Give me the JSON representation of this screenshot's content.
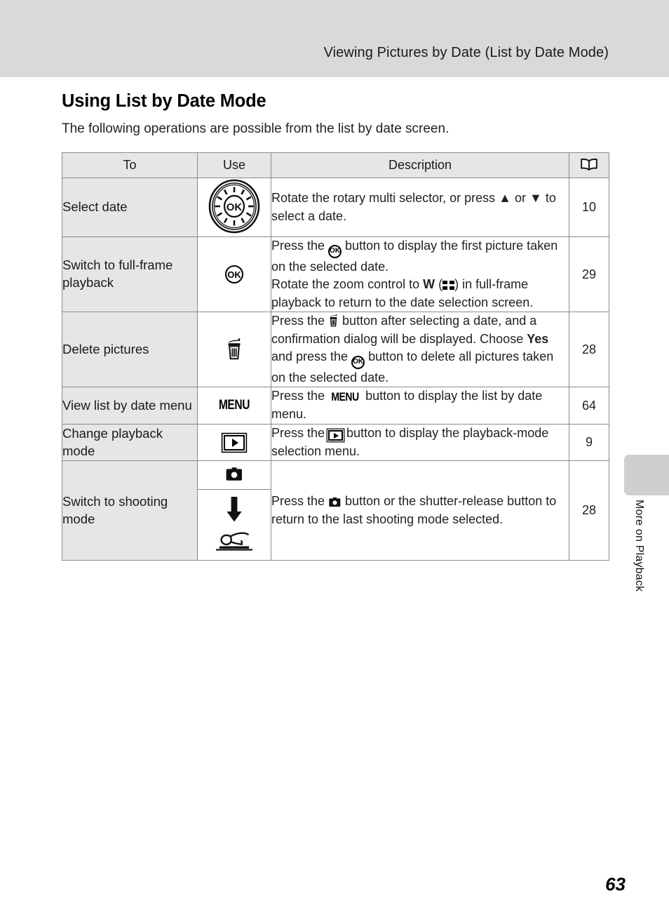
{
  "header": {
    "running_title": "Viewing Pictures by Date (List by Date Mode)"
  },
  "section": {
    "title": "Using List by Date Mode",
    "intro": "The following operations are possible from the list by date screen."
  },
  "table": {
    "columns": {
      "to": "To",
      "use": "Use",
      "description": "Description",
      "reference_icon": "open-book-icon"
    },
    "rows": [
      {
        "to": "Select date",
        "use_icon": "rotary-multi-selector-dial-icon",
        "description_parts": [
          {
            "text": "Rotate the rotary multi selector, or press "
          },
          {
            "icon": "up-triangle-icon",
            "glyph": "▲"
          },
          {
            "text": " or "
          },
          {
            "icon": "down-triangle-icon",
            "glyph": "▼"
          },
          {
            "text": " to select a date."
          }
        ],
        "reference": "10"
      },
      {
        "to": "Switch to full-frame playback",
        "use_icon": "ok-button-icon",
        "use_label": "OK",
        "description_parts": [
          {
            "text": "Press the "
          },
          {
            "icon": "ok-button-icon",
            "glyph": "OK"
          },
          {
            "text": " button to display the first picture taken on the selected date."
          },
          {
            "break": true
          },
          {
            "text": "Rotate the zoom control to "
          },
          {
            "bold": "W"
          },
          {
            "text": " ("
          },
          {
            "icon": "thumbnail-view-icon"
          },
          {
            "text": ") in full-frame playback to return to the date selection screen."
          }
        ],
        "reference": "29"
      },
      {
        "to": "Delete pictures",
        "use_icon": "trash-can-icon",
        "description_parts": [
          {
            "text": "Press the "
          },
          {
            "icon": "trash-can-icon"
          },
          {
            "text": " button after selecting a date, and a confirmation dialog will be displayed. Choose "
          },
          {
            "bold": "Yes"
          },
          {
            "text": " and press the "
          },
          {
            "icon": "ok-button-icon",
            "glyph": "OK"
          },
          {
            "text": " button to delete all pictures taken on the selected date."
          }
        ],
        "reference": "28"
      },
      {
        "to": "View list by date menu",
        "use_icon": "menu-button-icon",
        "use_label": "MENU",
        "description_parts": [
          {
            "text": "Press the "
          },
          {
            "icon": "menu-button-icon",
            "glyph": "MENU"
          },
          {
            "text": " button to display the list by date menu."
          }
        ],
        "reference": "64"
      },
      {
        "to": "Change playback mode",
        "use_icon": "playback-button-icon",
        "description_parts": [
          {
            "text": "Press the "
          },
          {
            "icon": "playback-button-icon"
          },
          {
            "text": " button to display the playback-mode selection menu."
          }
        ],
        "reference": "9"
      },
      {
        "to": "Switch to shooting mode",
        "use_icon_top": "camera-button-icon",
        "use_icon_bottom": "shutter-release-press-icon",
        "description_parts": [
          {
            "text": "Press the "
          },
          {
            "icon": "camera-button-icon"
          },
          {
            "text": " button or the shutter-release button to return to the last shooting mode selected."
          }
        ],
        "reference": "28"
      }
    ]
  },
  "side_tab": {
    "label": "More on Playback"
  },
  "footer": {
    "page_number": "63"
  }
}
